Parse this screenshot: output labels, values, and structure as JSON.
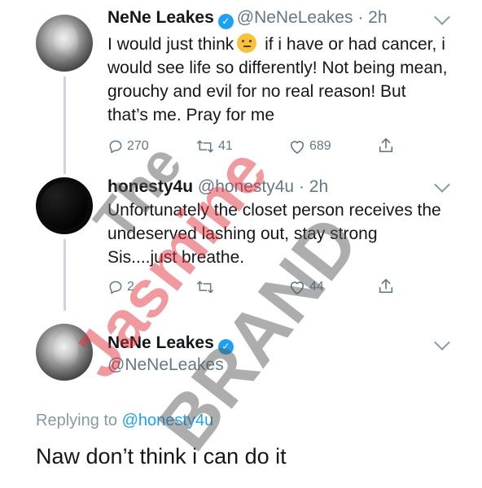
{
  "tweets": [
    {
      "name": "NeNe Leakes",
      "handle": "@NeNeLeakes",
      "time": "· 2h",
      "text_part1": "I would just think",
      "text_part2": " if i have or had cancer, i would see life so differently! Not being mean, grouchy and evil for no real reason! But that’s me. Pray for me",
      "reply_count": "270",
      "retweet_count": "41",
      "like_count": "689"
    },
    {
      "name": "honesty4u",
      "handle": "@honesty4u",
      "time": "· 2h",
      "text": "Unfortunately the closet person receives the undeserved lashing out, stay strong Sis....just breathe.",
      "reply_count": "2",
      "retweet_count": "",
      "like_count": "44"
    }
  ],
  "reply_tweet": {
    "name": "NeNe Leakes",
    "handle": "@NeNeLeakes",
    "replying_prefix": "Replying to ",
    "replying_mention": "@honesty4u",
    "text": "Naw don’t think i can do it"
  },
  "watermark": {
    "text1": "The",
    "text2": "Jasmine",
    "text3": "BRAND"
  },
  "icons": {
    "reply": "reply-icon",
    "retweet": "retweet-icon",
    "like": "heart-icon",
    "share": "share-icon",
    "verified": "verified-badge-icon",
    "menu": "chevron-down-icon"
  },
  "colors": {
    "accent": "#1da1f2",
    "secondary_text": "#657786",
    "watermark_red": "#e0323a"
  }
}
